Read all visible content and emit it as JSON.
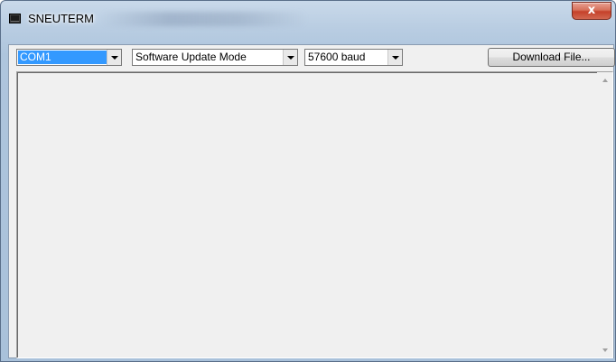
{
  "window": {
    "title": "SNEUTERM",
    "icon": "terminal-app-icon",
    "close_glyph": "x"
  },
  "toolbar": {
    "port": {
      "value": "COM1",
      "icon": "chevron-down-icon"
    },
    "mode": {
      "value": "Software Update Mode",
      "icon": "chevron-down-icon"
    },
    "baud": {
      "value": "57600 baud",
      "icon": "chevron-down-icon"
    },
    "download_label": "Download File..."
  },
  "terminal": {
    "content": ""
  },
  "colors": {
    "selection": "#3399ff",
    "close_button": "#c5412a",
    "client_background": "#f0f0f0"
  }
}
